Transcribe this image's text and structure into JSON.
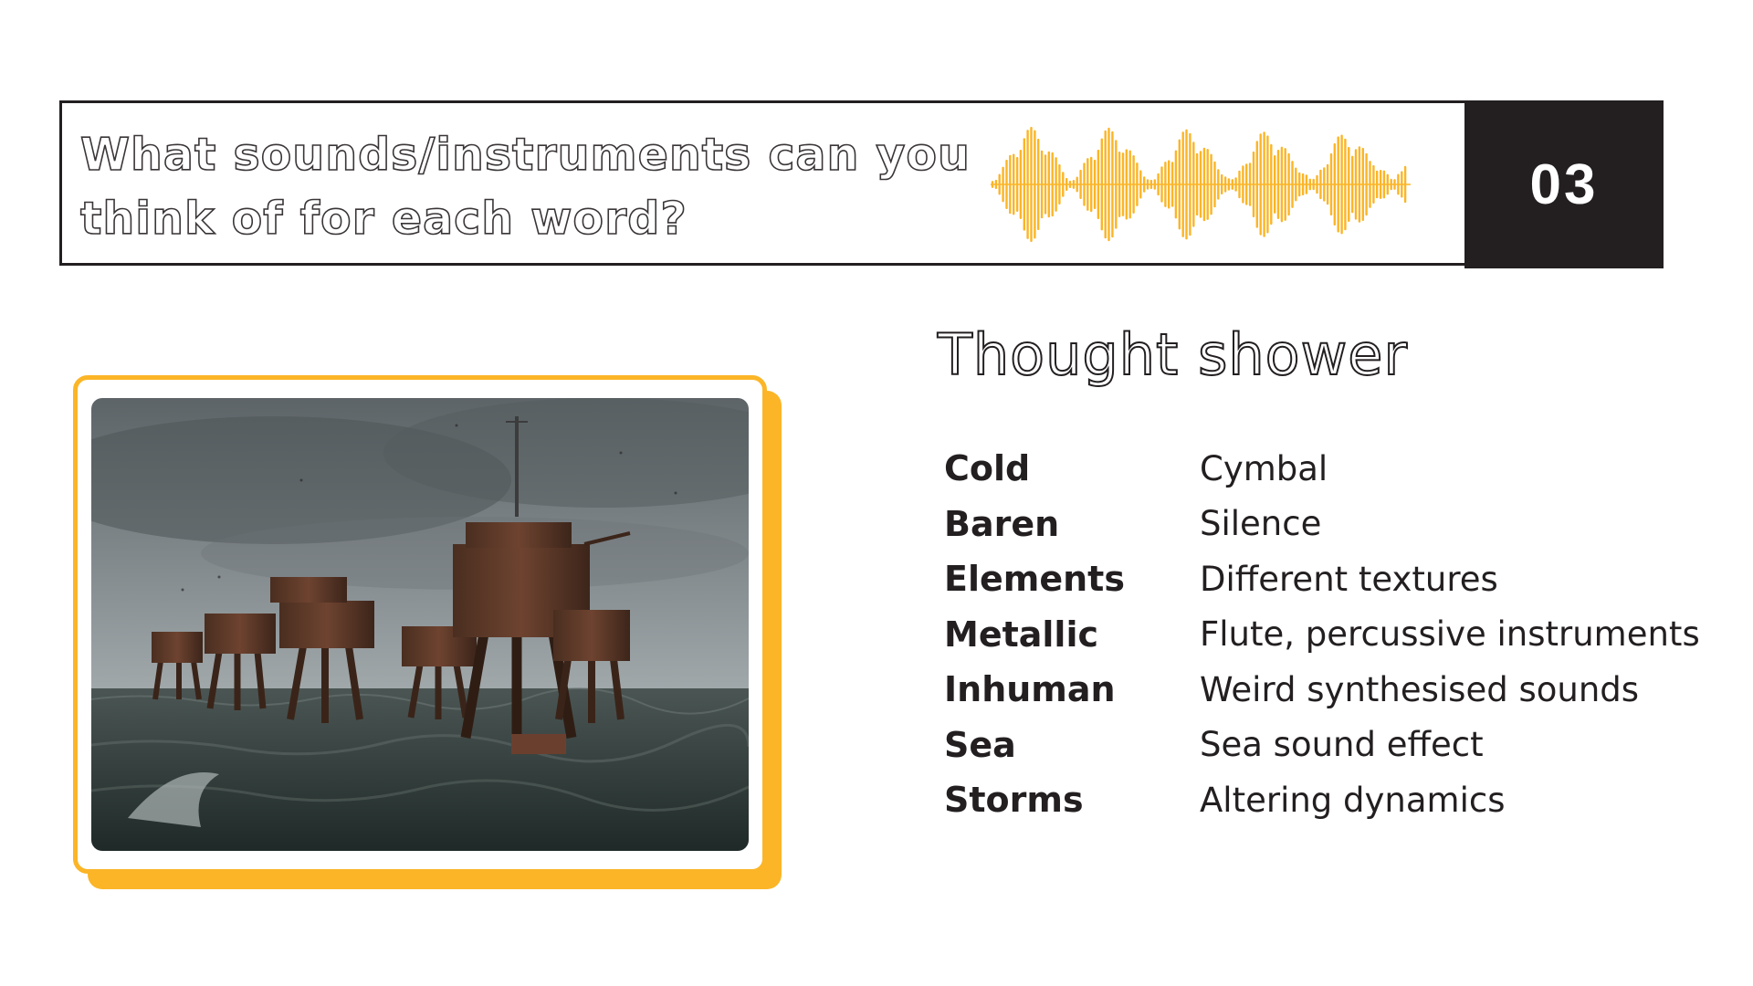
{
  "header": {
    "question": "What sounds/instruments can you think of for each word?",
    "slide_number": "03",
    "waveform_icon": "audio-waveform-icon"
  },
  "image": {
    "subject": "maunsell-sea-forts-photo",
    "frame_color": "#fbb527"
  },
  "section": {
    "title": "Thought shower"
  },
  "words": [
    {
      "term": "Cold",
      "sound": "Cymbal"
    },
    {
      "term": "Baren",
      "sound": "Silence"
    },
    {
      "term": "Elements",
      "sound": "Different textures"
    },
    {
      "term": "Metallic",
      "sound": "Flute, percussive instruments"
    },
    {
      "term": "Inhuman",
      "sound": "Weird synthesised sounds"
    },
    {
      "term": "Sea",
      "sound": "Sea sound effect"
    },
    {
      "term": "Storms",
      "sound": "Altering dynamics"
    }
  ],
  "colors": {
    "accent": "#fbb527",
    "dark": "#231f20",
    "background": "#ffffff"
  }
}
